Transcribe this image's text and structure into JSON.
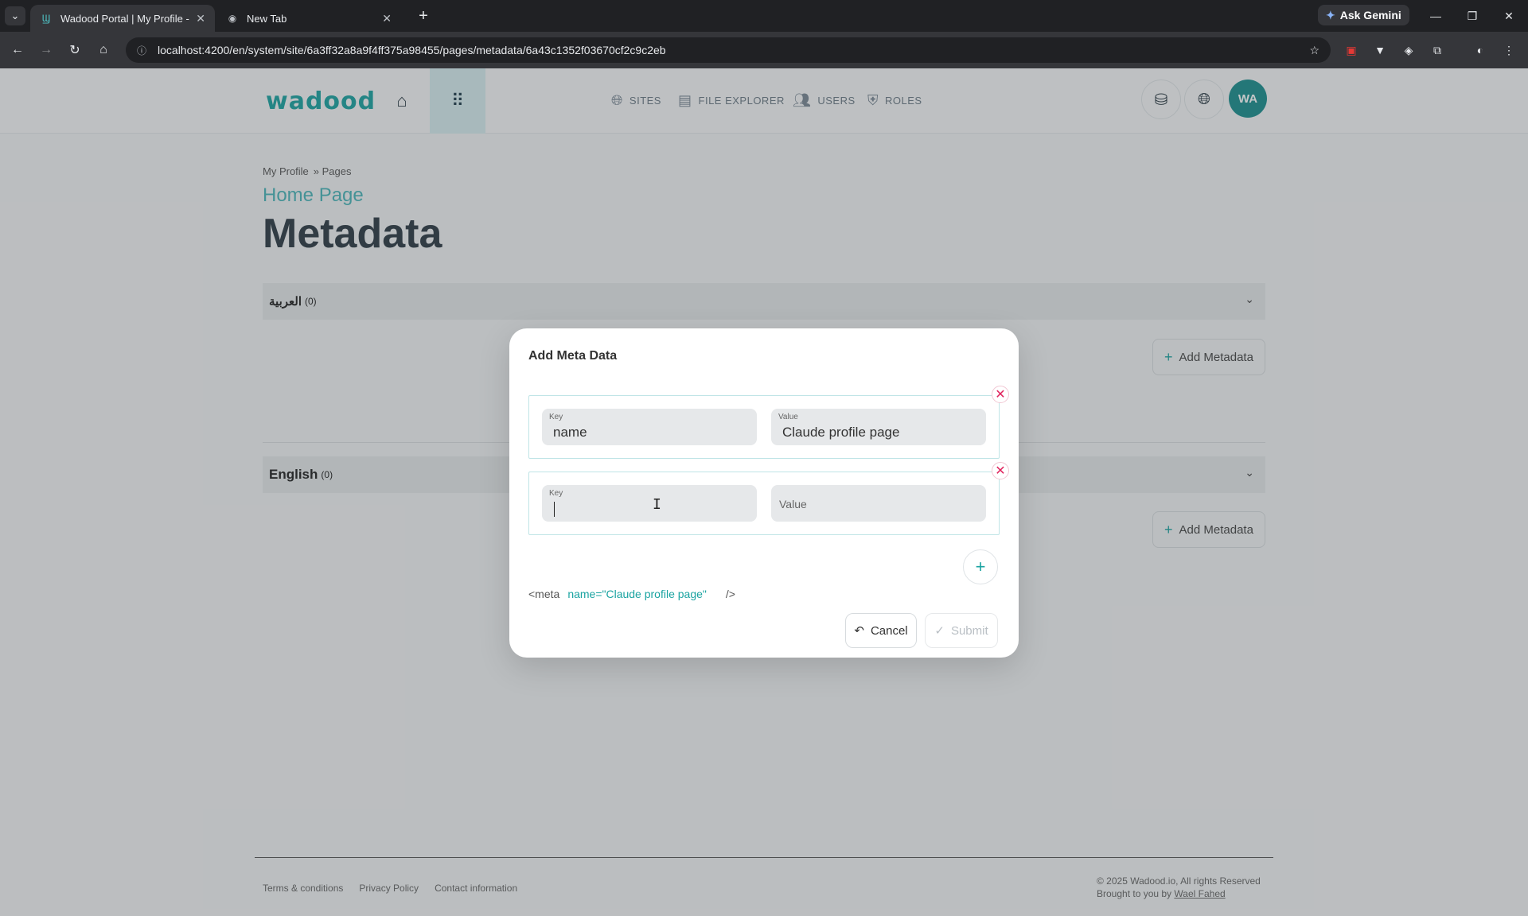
{
  "browser": {
    "tabs": [
      {
        "title": "Wadood Portal | My Profile - M",
        "active": true
      },
      {
        "title": "New Tab",
        "active": false
      }
    ],
    "gemini_label": "Ask Gemini",
    "url": "localhost:4200/en/system/site/6a3ff32a8a9f4ff375a98455/pages/metadata/6a43c1352f03670cf2c9c2eb"
  },
  "header": {
    "logo": "wadood",
    "nav": [
      {
        "label": "SITES",
        "icon": "globe-icon"
      },
      {
        "label": "FILE EXPLORER",
        "icon": "images-icon"
      },
      {
        "label": "USERS",
        "icon": "users-icon"
      },
      {
        "label": "ROLES",
        "icon": "shield-icon"
      }
    ],
    "avatar_initials": "WA"
  },
  "page": {
    "breadcrumb": [
      "My Profile",
      "» Pages"
    ],
    "subtitle": "Home Page",
    "title": "Metadata",
    "sections": [
      {
        "label": "العربية",
        "count": "(0)",
        "add_label": "Add Metadata"
      },
      {
        "label": "English",
        "count": "(0)",
        "add_label": "Add Metadata"
      }
    ]
  },
  "dialog": {
    "title": "Add Meta Data",
    "rows": [
      {
        "key_label": "Key",
        "key_value": "name",
        "value_label": "Value",
        "value_value": "Claude profile page"
      },
      {
        "key_label": "Key",
        "key_value": "",
        "value_label": "",
        "value_placeholder": "Value"
      }
    ],
    "preview": {
      "open": "<meta",
      "attr": "name=\"Claude profile page\"",
      "close": "/>"
    },
    "cancel_label": "Cancel",
    "submit_label": "Submit"
  },
  "footer": {
    "links": [
      "Terms & conditions",
      "Privacy Policy",
      "Contact information"
    ],
    "copyright": "© 2025 Wadood.io, All rights Reserved",
    "brought_by": "Brought to you by",
    "author": "Wael Fahed"
  },
  "colors": {
    "accent": "#1aa3a1",
    "danger": "#e0245e",
    "avatar": "#1a8e8f"
  }
}
